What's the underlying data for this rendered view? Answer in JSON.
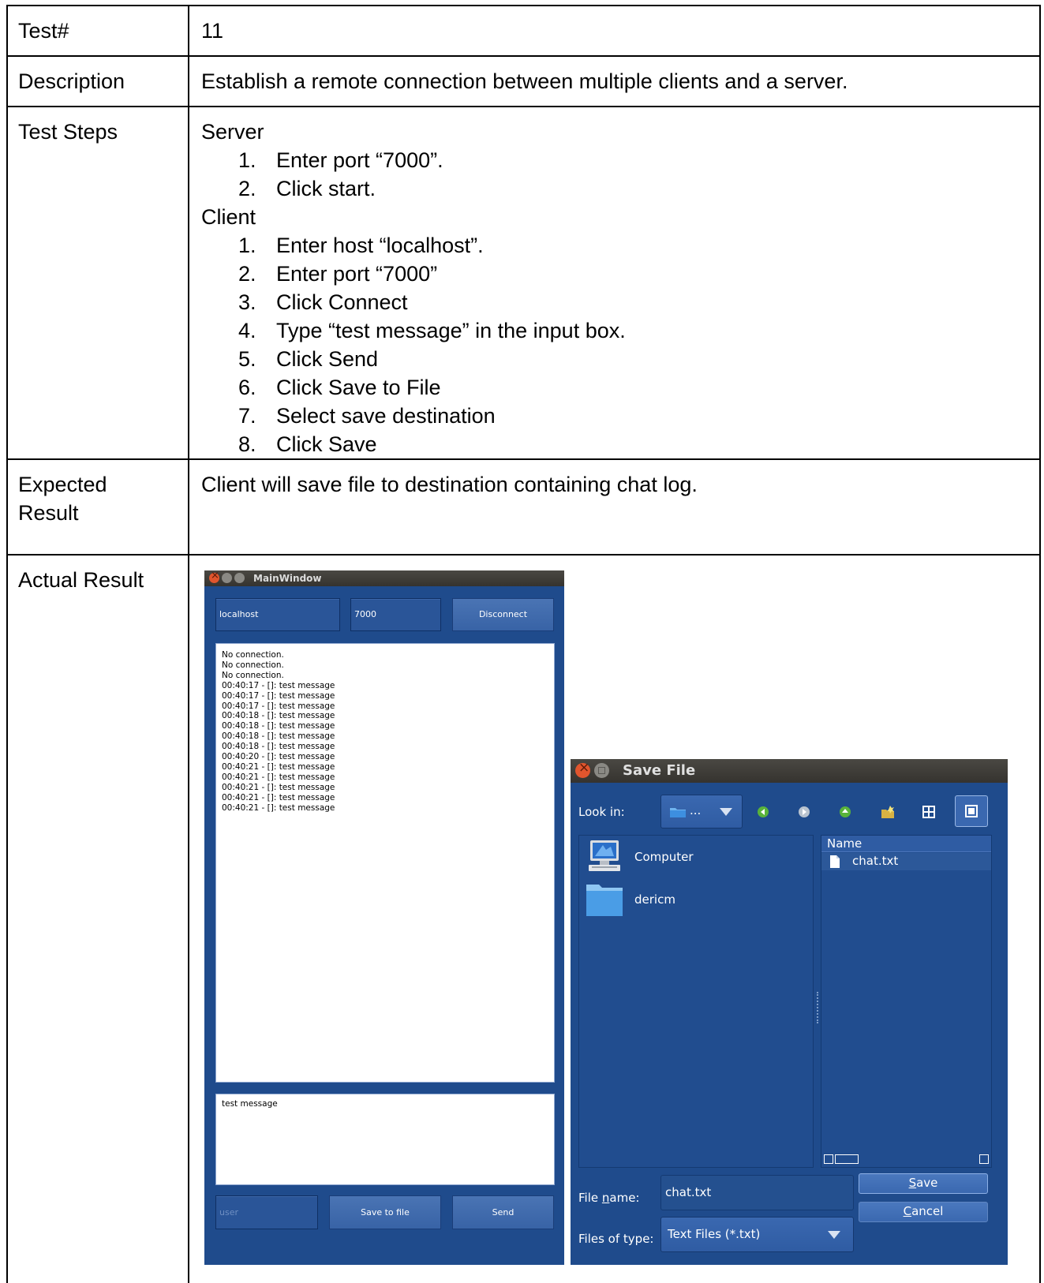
{
  "rows": {
    "test_label": "Test#",
    "test_value": "11",
    "description_label": "Description",
    "description_value": "Establish a remote connection between multiple clients and a server.",
    "steps_label": "Test Steps",
    "server_heading": "Server",
    "server_steps": [
      "Enter port “7000”.",
      "Click start."
    ],
    "client_heading": "Client",
    "client_steps": [
      "Enter host “localhost”.",
      "Enter port “7000”",
      "Click Connect",
      "Type “test message” in the input box.",
      "Click Send",
      "Click Save to File",
      "Select save destination",
      "Click Save"
    ],
    "expected_label_1": "Expected",
    "expected_label_2": "Result",
    "expected_value": "Client will save file to destination containing chat log.",
    "actual_label": "Actual Result"
  },
  "main_window": {
    "title": "MainWindow",
    "host_value": "localhost",
    "port_value": "7000",
    "disconnect_label": "Disconnect",
    "log_lines": [
      "No connection.",
      "No connection.",
      "No connection.",
      "00:40:17 - []: test message",
      "00:40:17 - []: test message",
      "00:40:17 - []: test message",
      "00:40:18 - []: test message",
      "00:40:18 - []: test message",
      "00:40:18 - []: test message",
      "00:40:18 - []: test message",
      "00:40:20 - []: test message",
      "00:40:21 - []: test message",
      "00:40:21 - []: test message",
      "00:40:21 - []: test message",
      "00:40:21 - []: test message",
      "00:40:21 - []: test message"
    ],
    "input_value": "test message",
    "user_placeholder": "user",
    "save_to_file_label": "Save to file",
    "send_label": "Send"
  },
  "save_dialog": {
    "title": "Save File",
    "look_in_label": "Look in:",
    "look_in_value": "...",
    "places": [
      "Computer",
      "dericm"
    ],
    "name_header": "Name",
    "files": [
      "chat.txt"
    ],
    "file_name_label_pre": "File ",
    "file_name_label_mnemonic": "n",
    "file_name_label_post": "ame:",
    "file_name_value": "chat.txt",
    "files_of_type_label": "Files of type:",
    "files_of_type_value": "Text Files (*.txt)",
    "save_mnemonic": "S",
    "save_rest": "ave",
    "cancel_mnemonic": "C",
    "cancel_rest": "ancel"
  },
  "colors": {
    "window_bg": "#1f4b8c",
    "titlebar": "#3f3d39",
    "close_button": "#e1552d"
  },
  "icons": [
    "folder-icon",
    "back-arrow-icon",
    "forward-arrow-icon",
    "up-arrow-icon",
    "new-folder-icon",
    "list-view-icon",
    "detail-view-icon",
    "computer-icon",
    "file-icon",
    "dropdown-icon"
  ]
}
